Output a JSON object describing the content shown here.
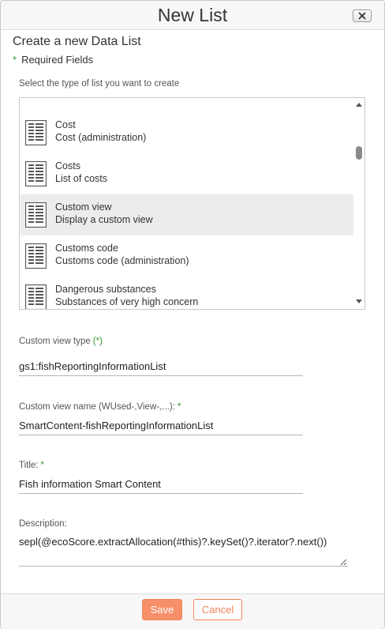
{
  "dialog": {
    "title": "New List",
    "close_icon": "close-icon"
  },
  "form": {
    "heading": "Create a new Data List",
    "required_star": "*",
    "required_note": "Required Fields",
    "list_type_label": "Select the type of list you want to create"
  },
  "list_items": [
    {
      "name": "Cost",
      "description": "Cost (administration)",
      "icon": "document-list-icon",
      "selected": false
    },
    {
      "name": "Costs",
      "description": "List of costs",
      "icon": "document-list-icon",
      "selected": false
    },
    {
      "name": "Custom view",
      "description": "Display a custom view",
      "icon": "document-list-icon",
      "selected": true
    },
    {
      "name": "Customs code",
      "description": "Customs code (administration)",
      "icon": "document-list-icon",
      "selected": false
    },
    {
      "name": "Dangerous substances",
      "description": "Substances of very high concern",
      "icon": "document-list-icon",
      "selected": false
    }
  ],
  "fields": {
    "custom_view_type": {
      "label": "Custom view type",
      "required_mark": "(*)",
      "value": "gs1:fishReportingInformationList"
    },
    "custom_view_name": {
      "label": "Custom view name (WUsed-,View-,...):",
      "required_mark": "*",
      "value": "SmartContent-fishReportingInformationList"
    },
    "title": {
      "label": "Title:",
      "required_mark": "*",
      "value": "Fish information Smart Content"
    },
    "description": {
      "label": "Description:",
      "value": "sepl(@ecoScore.extractAllocation(#this)?.keySet()?.iterator?.next())"
    }
  },
  "buttons": {
    "save": "Save",
    "cancel": "Cancel"
  },
  "colors": {
    "accent": "#f7906a",
    "required": "#2e9b2e",
    "selected_row": "#ececec"
  }
}
